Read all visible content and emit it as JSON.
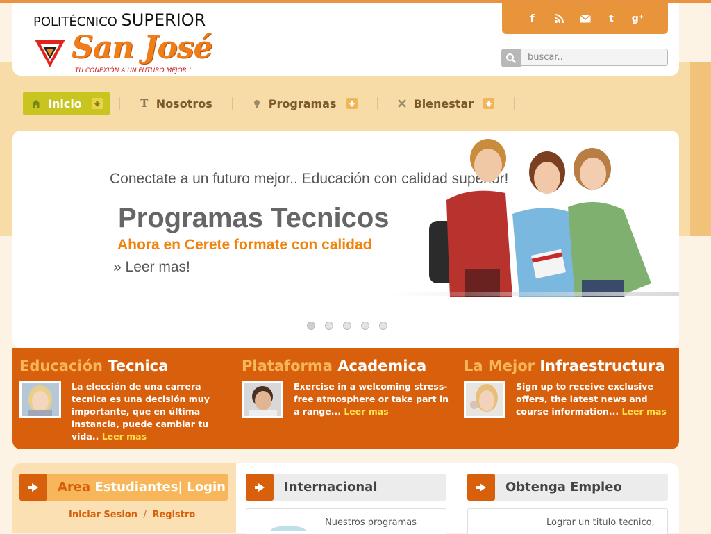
{
  "header": {
    "logo_top_small": "POLITÉCNICO",
    "logo_top_big": "SUPERIOR",
    "logo_name": "San José",
    "logo_tagline": "TU CONEXIÓN A UN FUTURO MEJOR !"
  },
  "social": [
    {
      "icon": "facebook-icon",
      "glyph": "f"
    },
    {
      "icon": "rss-icon",
      "glyph": "◔"
    },
    {
      "icon": "email-icon",
      "glyph": "✉"
    },
    {
      "icon": "twitter-icon",
      "glyph": "t"
    },
    {
      "icon": "google-plus-icon",
      "glyph": "g⁺"
    }
  ],
  "search": {
    "placeholder": "buscar.."
  },
  "nav": {
    "items": [
      {
        "label": "Inicio",
        "icon": "home-icon",
        "active": true,
        "dropdown": true
      },
      {
        "label": "Nosotros",
        "icon": "text-t-icon",
        "active": false,
        "dropdown": false
      },
      {
        "label": "Programas",
        "icon": "lightbulb-icon",
        "active": false,
        "dropdown": true
      },
      {
        "label": "Bienestar",
        "icon": "tools-icon",
        "active": false,
        "dropdown": true
      }
    ]
  },
  "hero": {
    "tagline": "Conectate a un futuro mejor.. Educación con calidad superior!",
    "title": "Programas Tecnicos",
    "subtitle": "Ahora en Cerete formate con calidad",
    "link": "» Leer mas!",
    "slides": 5,
    "active_slide": 1
  },
  "features": [
    {
      "title_highlight": "Educación",
      "title_rest": "Tecnica",
      "text": "La elección de una carrera tecnica es una decisión muy importante, que en última instancia, puede cambiar tu vida..",
      "more": "Leer mas"
    },
    {
      "title_highlight": "Plataforma",
      "title_rest": "Academica",
      "text": "Exercise in a welcoming stress-free atmosphere or take part in a range...",
      "more": "Leer mas"
    },
    {
      "title_highlight": "La Mejor",
      "title_rest": "Infraestructura",
      "text": "Sign up to receive exclusive offers, the latest news and course information...",
      "more": "Leer mas"
    }
  ],
  "bottom": {
    "students": {
      "title_highlight": "Area",
      "title_rest": "Estudiantes| Login",
      "login": "Iniciar Sesion",
      "separator": "/",
      "register": "Registro"
    },
    "internacional": {
      "title": "Internacional",
      "text": "Nuestros programas"
    },
    "empleo": {
      "title": "Obtenga Empleo",
      "text": "Lograr un titulo tecnico,"
    }
  },
  "colors": {
    "accent_orange": "#d8600d",
    "nav_active": "#c8c520",
    "page_bg": "#fdf3e4"
  }
}
